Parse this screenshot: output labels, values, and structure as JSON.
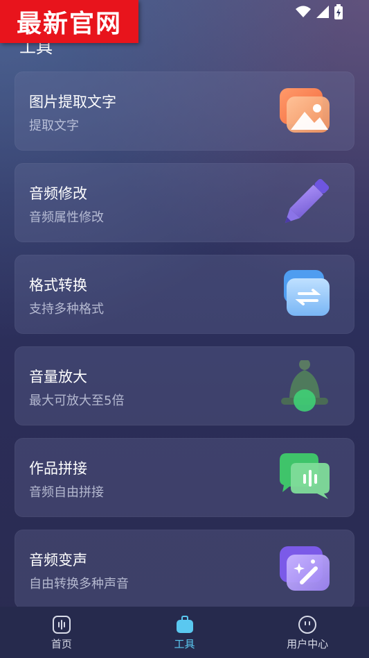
{
  "banner": {
    "text": "最新官网"
  },
  "header": {
    "title": "工具"
  },
  "tools": [
    {
      "title": "图片提取文字",
      "subtitle": "提取文字",
      "icon": "image-icon"
    },
    {
      "title": "音频修改",
      "subtitle": "音频属性修改",
      "icon": "pencil-icon"
    },
    {
      "title": "格式转换",
      "subtitle": "支持多种格式",
      "icon": "convert-icon"
    },
    {
      "title": "音量放大",
      "subtitle": "最大可放大至5倍",
      "icon": "bell-icon"
    },
    {
      "title": "作品拼接",
      "subtitle": "音频自由拼接",
      "icon": "chat-audio-icon"
    },
    {
      "title": "音频变声",
      "subtitle": "自由转换多种声音",
      "icon": "magic-wand-icon"
    }
  ],
  "tabbar": {
    "items": [
      {
        "label": "首页",
        "icon": "home-audio-icon",
        "active": false
      },
      {
        "label": "工具",
        "icon": "toolbox-icon",
        "active": true
      },
      {
        "label": "用户中心",
        "icon": "user-face-icon",
        "active": false
      }
    ],
    "active_color": "#5ac8f0"
  }
}
